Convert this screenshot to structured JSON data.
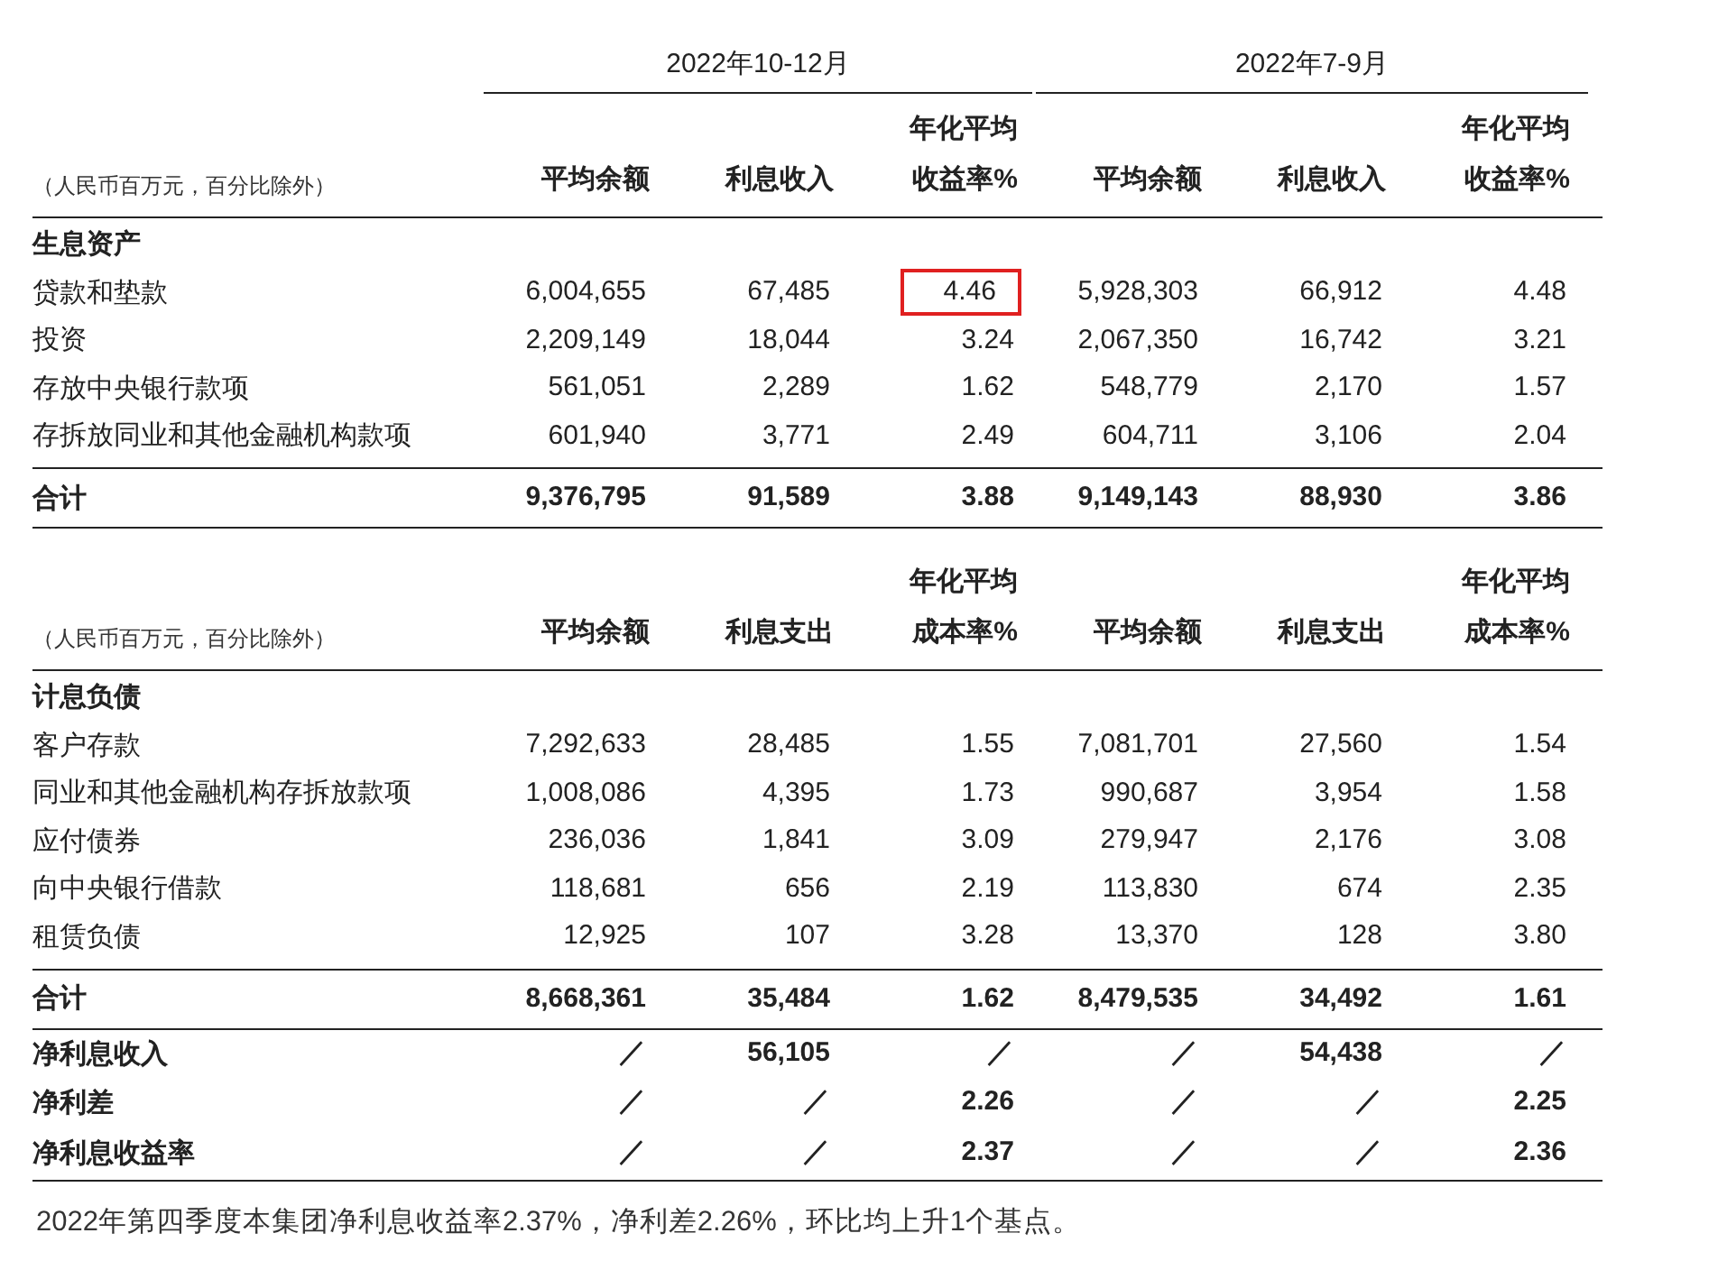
{
  "tables": [
    {
      "periods": [
        "2022年10-12月",
        "2022年7-9月"
      ],
      "unit_note": "（人民币百万元，百分比除外）",
      "columns": [
        {
          "lines": [
            "平均余额"
          ]
        },
        {
          "lines": [
            "利息收入"
          ]
        },
        {
          "lines": [
            "年化平均",
            "收益率%"
          ]
        },
        {
          "lines": [
            "平均余额"
          ]
        },
        {
          "lines": [
            "利息收入"
          ]
        },
        {
          "lines": [
            "年化平均",
            "收益率%"
          ]
        }
      ],
      "section": "生息资产",
      "rows": [
        {
          "kind": "item",
          "label": "贷款和垫款",
          "cells": [
            "6,004,655",
            "67,485",
            "4.46",
            "5,928,303",
            "66,912",
            "4.48"
          ],
          "highlight": [
            false,
            false,
            true,
            false,
            false,
            false
          ]
        },
        {
          "kind": "item",
          "label": "投资",
          "cells": [
            "2,209,149",
            "18,044",
            "3.24",
            "2,067,350",
            "16,742",
            "3.21"
          ]
        },
        {
          "kind": "item",
          "label": "存放中央银行款项",
          "cells": [
            "561,051",
            "2,289",
            "1.62",
            "548,779",
            "2,170",
            "1.57"
          ]
        },
        {
          "kind": "item",
          "label": "存拆放同业和其他金融机构款项",
          "cells": [
            "601,940",
            "3,771",
            "2.49",
            "604,711",
            "3,106",
            "2.04"
          ]
        },
        {
          "kind": "total",
          "label": "合计",
          "cells": [
            "9,376,795",
            "91,589",
            "3.88",
            "9,149,143",
            "88,930",
            "3.86"
          ]
        }
      ]
    },
    {
      "unit_note": "（人民币百万元，百分比除外）",
      "columns": [
        {
          "lines": [
            "平均余额"
          ]
        },
        {
          "lines": [
            "利息支出"
          ]
        },
        {
          "lines": [
            "年化平均",
            "成本率%"
          ]
        },
        {
          "lines": [
            "平均余额"
          ]
        },
        {
          "lines": [
            "利息支出"
          ]
        },
        {
          "lines": [
            "年化平均",
            "成本率%"
          ]
        }
      ],
      "section": "计息负债",
      "rows": [
        {
          "kind": "item",
          "label": "客户存款",
          "cells": [
            "7,292,633",
            "28,485",
            "1.55",
            "7,081,701",
            "27,560",
            "1.54"
          ]
        },
        {
          "kind": "item",
          "label": "同业和其他金融机构存拆放款项",
          "cells": [
            "1,008,086",
            "4,395",
            "1.73",
            "990,687",
            "3,954",
            "1.58"
          ]
        },
        {
          "kind": "item",
          "label": "应付债券",
          "cells": [
            "236,036",
            "1,841",
            "3.09",
            "279,947",
            "2,176",
            "3.08"
          ]
        },
        {
          "kind": "item",
          "label": "向中央银行借款",
          "cells": [
            "118,681",
            "656",
            "2.19",
            "113,830",
            "674",
            "2.35"
          ]
        },
        {
          "kind": "item",
          "label": "租赁负债",
          "cells": [
            "12,925",
            "107",
            "3.28",
            "13,370",
            "128",
            "3.80"
          ]
        },
        {
          "kind": "total",
          "label": "合计",
          "cells": [
            "8,668,361",
            "35,484",
            "1.62",
            "8,479,535",
            "34,492",
            "1.61"
          ]
        },
        {
          "kind": "summary",
          "label": "净利息收入",
          "cells": [
            "／",
            "56,105",
            "／",
            "／",
            "54,438",
            "／"
          ]
        },
        {
          "kind": "summary",
          "label": "净利差",
          "cells": [
            "／",
            "／",
            "2.26",
            "／",
            "／",
            "2.25"
          ]
        },
        {
          "kind": "summary",
          "label": "净利息收益率",
          "cells": [
            "／",
            "／",
            "2.37",
            "／",
            "／",
            "2.36"
          ]
        }
      ]
    }
  ],
  "footnote": "2022年第四季度本集团净利息收益率2.37%，净利差2.26%，环比均上升1个基点。"
}
